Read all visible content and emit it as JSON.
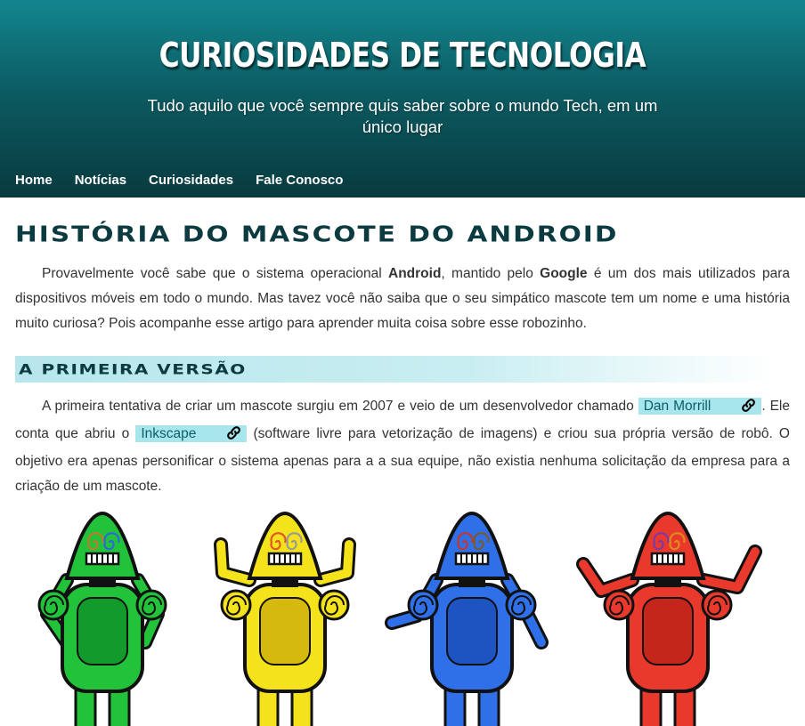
{
  "header": {
    "title": "CURIOSIDADES DE TECNOLOGIA",
    "subtitle": "Tudo aquilo que você sempre quis saber sobre o mundo Tech, em um único lugar",
    "gradient_top": "#13868f",
    "gradient_bottom": "#083a3e"
  },
  "nav": {
    "items": [
      {
        "label": "Home"
      },
      {
        "label": "Notícias"
      },
      {
        "label": "Curiosidades"
      },
      {
        "label": "Fale Conosco"
      }
    ]
  },
  "article": {
    "title": "História do Mascote do Android",
    "intro": {
      "part1": "Provavelmente você sabe que o sistema operacional ",
      "android": "Android",
      "part2": ", mantido pelo ",
      "google": "Google",
      "part3": " é um dos mais utilizados para dispositivos móveis em todo o mundo. Mas tavez você não saiba que o seu simpático mascote tem um nome e uma história muito curiosa? Pois acompanhe esse artigo para aprender muita coisa sobre esse robozinho."
    },
    "section1": {
      "title": "A Primeira Versão",
      "part1": "A primeira tentativa de criar um mascote surgiu em 2007 e veio de um desenvolvedor chamado ",
      "link1": "Dan Morrill",
      "part2": ". Ele conta que abriu o ",
      "link2": "Inkscape",
      "part3": " (software livre para vetorização de imagens) e criou sua própria versão de robô. O objetivo era apenas personificar o sistema apenas para a a sua equipe, não existia nenhuma solicitação da empresa para a criação de um mascote."
    }
  },
  "colors": {
    "title_text": "#0b3b40",
    "link_bg": "#a8e6ee",
    "link_text": "#0b5e67"
  },
  "mascots": [
    {
      "name": "green-robot",
      "fill": "#22c33a",
      "shade": "#129a2a"
    },
    {
      "name": "yellow-robot",
      "fill": "#f4e21a",
      "shade": "#d6b90e"
    },
    {
      "name": "blue-robot",
      "fill": "#2f6fe8",
      "shade": "#1d54c2"
    },
    {
      "name": "red-robot",
      "fill": "#e8392c",
      "shade": "#c4261c"
    }
  ]
}
